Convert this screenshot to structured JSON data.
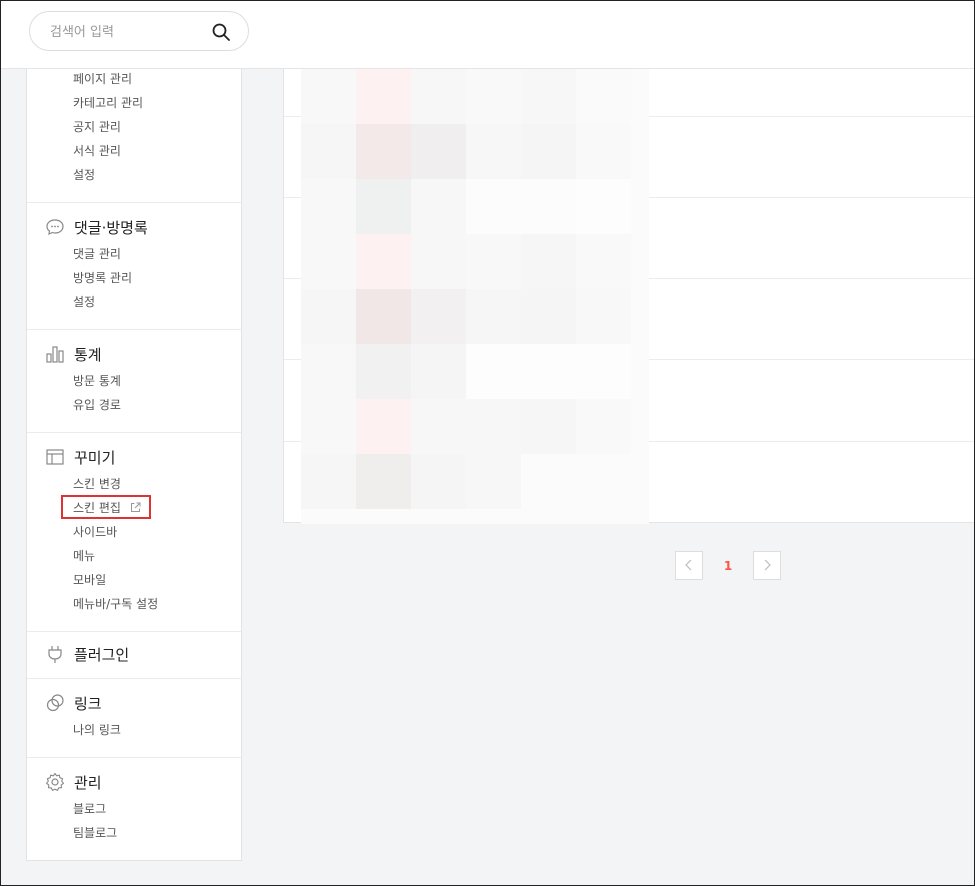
{
  "search": {
    "placeholder": "검색어 입력",
    "value": ""
  },
  "sidebar": {
    "top_items": [
      "페이지 관리",
      "카테고리 관리",
      "공지 관리",
      "서식 관리",
      "설정"
    ],
    "comments": {
      "title": "댓글·방명록",
      "items": [
        "댓글 관리",
        "방명록 관리",
        "설정"
      ]
    },
    "stats": {
      "title": "통계",
      "items": [
        "방문 통계",
        "유입 경로"
      ]
    },
    "decorate": {
      "title": "꾸미기",
      "items": [
        "스킨 변경",
        "스킨 편집",
        "사이드바",
        "메뉴",
        "모바일",
        "메뉴바/구독 설정"
      ]
    },
    "plugin": {
      "title": "플러그인"
    },
    "link": {
      "title": "링크",
      "items": [
        "나의 링크"
      ]
    },
    "manage": {
      "title": "관리",
      "items": [
        "블로그",
        "팀블로그"
      ]
    }
  },
  "pagination": {
    "current": "1"
  },
  "colors": {
    "accent": "#ff5544",
    "highlight_border": "#dd3333"
  },
  "icons": [
    "search-icon",
    "chat-bubble-icon",
    "bar-chart-icon",
    "layout-icon",
    "plug-icon",
    "link-circles-icon",
    "gear-icon",
    "external-link-icon",
    "chevron-left-icon",
    "chevron-right-icon"
  ]
}
